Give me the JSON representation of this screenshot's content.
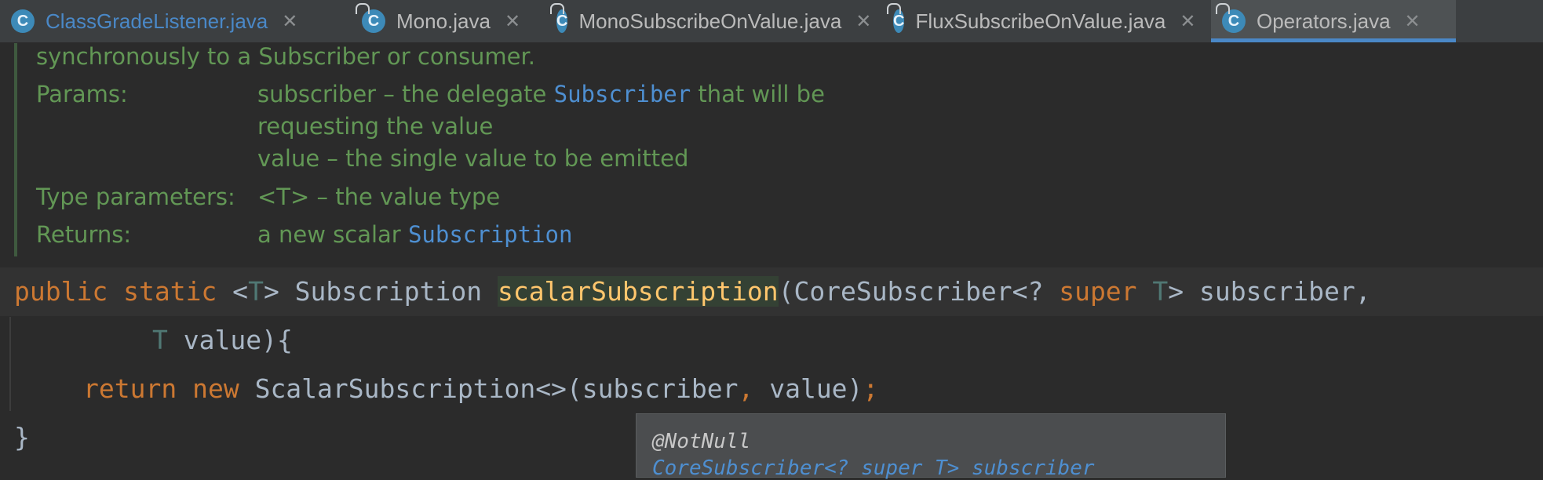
{
  "tabs": [
    {
      "label": "ClassGradeListener.java",
      "icon": "class-icon",
      "active": false,
      "locked": false
    },
    {
      "label": "Mono.java",
      "icon": "class-locked-icon",
      "active": false,
      "locked": true
    },
    {
      "label": "MonoSubscribeOnValue.java",
      "icon": "class-locked-icon",
      "active": false,
      "locked": true
    },
    {
      "label": "FluxSubscribeOnValue.java",
      "icon": "class-locked-icon",
      "active": false,
      "locked": true
    },
    {
      "label": "Operators.java",
      "icon": "class-locked-icon",
      "active": true,
      "locked": true
    }
  ],
  "tab_icon_letter": "C",
  "close_glyph": "✕",
  "doc": {
    "line1": "synchronously to a Subscriber or consumer.",
    "params_label": "Params:",
    "param1_pre": "subscriber – the delegate ",
    "param1_link": "Subscriber",
    "param1_post": " that will be",
    "param1_cont": "requesting the value",
    "param2": "value – the single value to be emitted",
    "typeparams_label": "Type parameters:",
    "typeparams_value": "<T> – the value type",
    "returns_label": "Returns:",
    "returns_pre": "a new scalar ",
    "returns_link": "Subscription"
  },
  "code": {
    "l1_public": "public",
    "l1_static": "static",
    "l1_lt": " <",
    "l1_T": "T",
    "l1_gt": "> Subscription ",
    "l1_method": "scalarSubscription",
    "l1_params": "(CoreSubscriber<? ",
    "l1_super": "super",
    "l1_T2": "T",
    "l1_end": "> subscriber,",
    "l1_comma": "",
    "l2_T": "T",
    "l2_rest": " value){",
    "l3_return": "return",
    "l3_new": "new",
    "l3_rest": " ScalarSubscription<>(subscriber",
    "l3_comma": ",",
    "l3_tail": " value)",
    "l3_semi": ";",
    "l4_brace": "}"
  },
  "popup": {
    "annotation": "@NotNull",
    "type": "CoreSubscriber<? super T> subscriber"
  },
  "colors": {
    "background": "#2b2b2b",
    "keyword": "#cc7832",
    "doc_text": "#629755",
    "link": "#4e8fd1",
    "method": "#ffc66d",
    "active_tab_underline": "#4a88c7"
  }
}
